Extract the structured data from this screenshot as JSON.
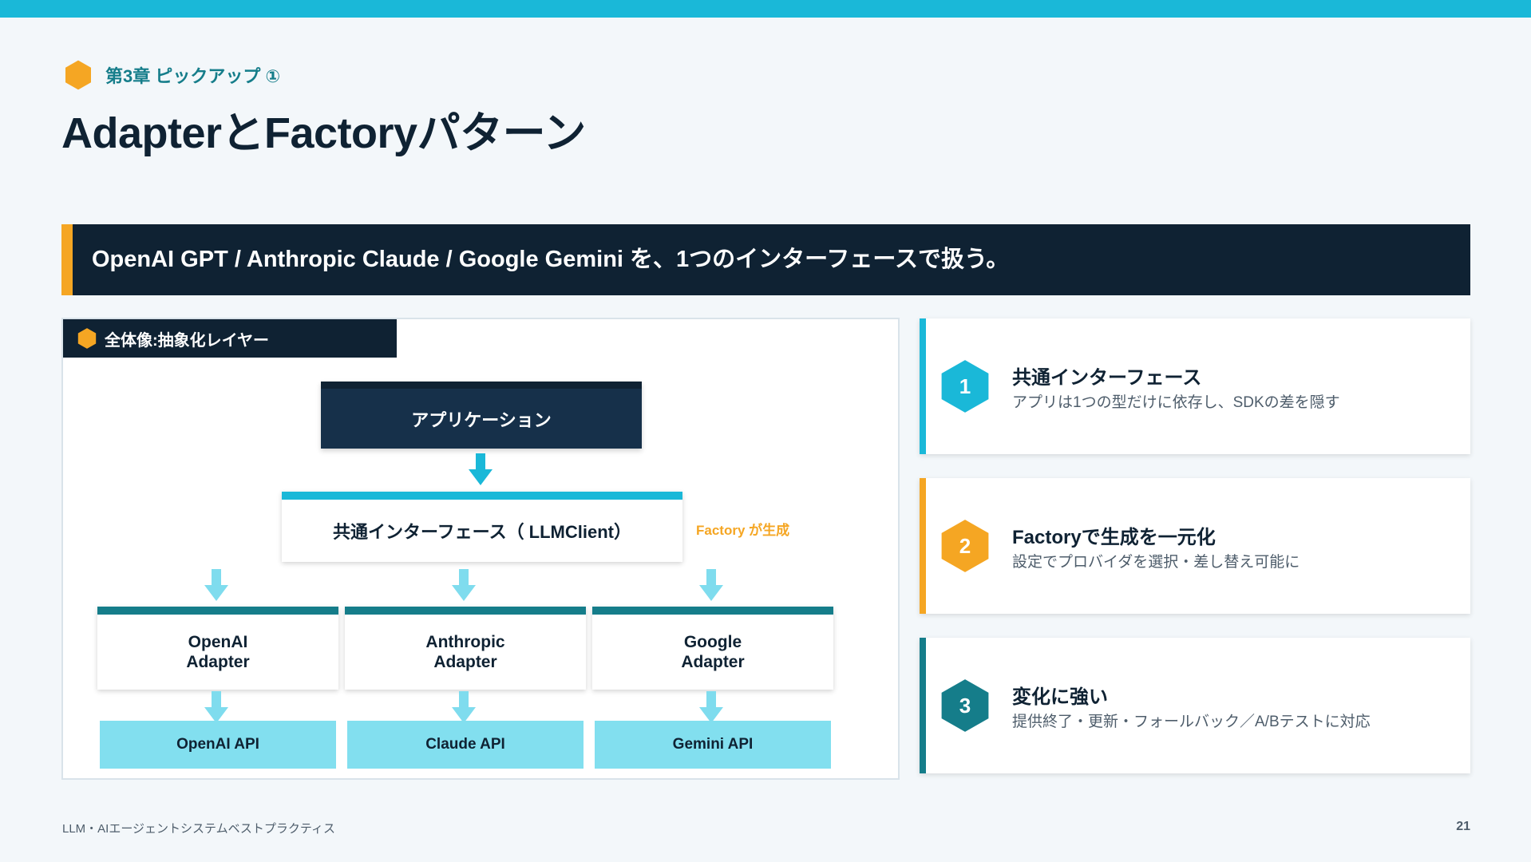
{
  "header": {
    "chapter_label": "第3章 ピックアップ ①",
    "title": "AdapterとFactoryパターン"
  },
  "banner": {
    "text": "OpenAI GPT / Anthropic Claude / Google Gemini を、1つのインターフェースで扱う。"
  },
  "diagram": {
    "panel_label": "全体像:抽象化レイヤー",
    "application": "アプリケーション",
    "interface": "共通インターフェース（ LLMClient）",
    "factory_note": "Factory が生成",
    "adapters": [
      {
        "label": "OpenAI\nAdapter",
        "api": "OpenAI API"
      },
      {
        "label": "Anthropic\nAdapter",
        "api": "Claude API"
      },
      {
        "label": "Google\nAdapter",
        "api": "Gemini API"
      }
    ]
  },
  "cards": [
    {
      "number": "1",
      "title": "共通インターフェース",
      "description": "アプリは1つの型だけに依存し、SDKの差を隠す",
      "color": "#1ab8d8"
    },
    {
      "number": "2",
      "title": "Factoryで生成を一元化",
      "description": "設定でプロバイダを選択・差し替え可能に",
      "color": "#f5a623"
    },
    {
      "number": "3",
      "title": "変化に強い",
      "description": "提供終了・更新・フォールバック／A/Bテストに対応",
      "color": "#157d8a"
    }
  ],
  "footer": {
    "deck_title": "LLM・AIエージェントシステムベストプラクティス",
    "page_number": "21"
  },
  "colors": {
    "navy": "#0f2233",
    "cyan": "#1ab8d8",
    "orange": "#f5a623",
    "teal": "#157d8a",
    "light_cyan": "#82dfef"
  }
}
